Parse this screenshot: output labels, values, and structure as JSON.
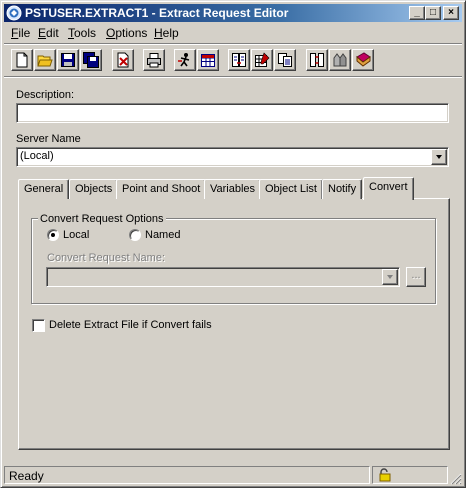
{
  "window": {
    "title": "PSTUSER.EXTRACT1 - Extract Request Editor",
    "controls": {
      "minimize": "_",
      "maximize": "□",
      "close": "×"
    }
  },
  "menu": [
    {
      "label": "File",
      "accel": "F",
      "rest": "ile"
    },
    {
      "label": "Edit",
      "accel": "E",
      "rest": "dit"
    },
    {
      "label": "Tools",
      "accel": "T",
      "rest": "ools"
    },
    {
      "label": "Options",
      "accel": "O",
      "rest": "ptions"
    },
    {
      "label": "Help",
      "accel": "H",
      "rest": "elp"
    }
  ],
  "toolbar": {
    "icons": [
      "new-icon",
      "open-icon",
      "save-icon",
      "save-as-icon",
      "delete-icon",
      "print-icon",
      "run-icon",
      "table-icon",
      "compare-icon",
      "edit-table-icon",
      "copy-icon",
      "relate-icon",
      "browse-icon",
      "book-icon"
    ]
  },
  "form": {
    "description_label": "Description:",
    "description_value": "",
    "server_label": "Server Name",
    "server_value": "(Local)"
  },
  "tabs": [
    "General",
    "Objects",
    "Point and Shoot",
    "Variables",
    "Object List",
    "Notify",
    "Convert"
  ],
  "active_tab": "Convert",
  "convert": {
    "group_title": "Convert Request Options",
    "radio_local": "Local",
    "radio_named": "Named",
    "selected": "Local",
    "request_name_label": "Convert Request Name:",
    "request_name_value": "",
    "browse_label": "...",
    "checkbox_label": "Delete Extract File if Convert fails",
    "checkbox_checked": false
  },
  "status": {
    "text": "Ready",
    "icon": "lock-icon"
  },
  "colors": {
    "face": "#d4d0c8",
    "title_start": "#0a246a",
    "title_end": "#a6caf0",
    "disabled": "#808080"
  }
}
